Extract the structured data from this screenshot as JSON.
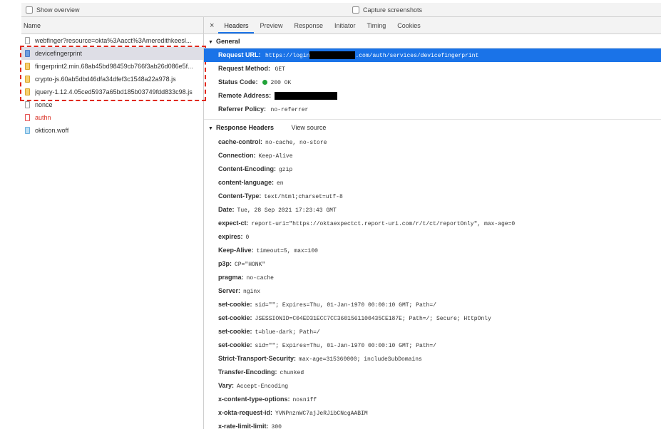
{
  "toolbar": {
    "show_overview": "Show overview",
    "capture_screenshots": "Capture screenshots"
  },
  "request_list": {
    "header": "Name",
    "items": [
      {
        "name": "webfinger?resource=okta%3Aacct%3Ameredithkeesl..."
      },
      {
        "name": "devicefingerprint"
      },
      {
        "name": "fingerprint2.min.68ab45bd98459cb766f3ab26d086e5f..."
      },
      {
        "name": "crypto-js.60ab5dbd46dfa34dfef3c1548a22a978.js"
      },
      {
        "name": "jquery-1.12.4.05ced5937a65bd185b03749fdd833c98.js"
      },
      {
        "name": "nonce"
      },
      {
        "name": "authn"
      },
      {
        "name": "okticon.woff"
      }
    ]
  },
  "tabs": [
    "Headers",
    "Preview",
    "Response",
    "Initiator",
    "Timing",
    "Cookies"
  ],
  "general": {
    "title": "General",
    "request_url_key": "Request URL:",
    "request_url_prefix": "https://login",
    "request_url_suffix": ".com/auth/services/devicefingerprint",
    "request_method_key": "Request Method:",
    "request_method": "GET",
    "status_code_key": "Status Code:",
    "status_code": "200 OK",
    "remote_address_key": "Remote Address:",
    "referrer_policy_key": "Referrer Policy:",
    "referrer_policy": "no-referrer"
  },
  "response_headers": {
    "title": "Response Headers",
    "view_source": "View source",
    "items": [
      {
        "key": "cache-control:",
        "value": "no-cache, no-store"
      },
      {
        "key": "Connection:",
        "value": "Keep-Alive"
      },
      {
        "key": "Content-Encoding:",
        "value": "gzip"
      },
      {
        "key": "content-language:",
        "value": "en"
      },
      {
        "key": "Content-Type:",
        "value": "text/html;charset=utf-8"
      },
      {
        "key": "Date:",
        "value": "Tue, 28 Sep 2021 17:23:43 GMT"
      },
      {
        "key": "expect-ct:",
        "value": "report-uri=\"https://oktaexpectct.report-uri.com/r/t/ct/reportOnly\", max-age=0"
      },
      {
        "key": "expires:",
        "value": "0"
      },
      {
        "key": "Keep-Alive:",
        "value": "timeout=5, max=100"
      },
      {
        "key": "p3p:",
        "value": "CP=\"HONK\""
      },
      {
        "key": "pragma:",
        "value": "no-cache"
      },
      {
        "key": "Server:",
        "value": "nginx"
      },
      {
        "key": "set-cookie:",
        "value": "sid=\"\"; Expires=Thu, 01-Jan-1970 00:00:10 GMT; Path=/"
      },
      {
        "key": "set-cookie:",
        "value": "JSESSIONID=C04ED31ECC7CC3601561100435CE187E; Path=/; Secure; HttpOnly"
      },
      {
        "key": "set-cookie:",
        "value": "t=blue-dark; Path=/"
      },
      {
        "key": "set-cookie:",
        "value": "sid=\"\"; Expires=Thu, 01-Jan-1970 00:00:10 GMT; Path=/"
      },
      {
        "key": "Strict-Transport-Security:",
        "value": "max-age=315360000; includeSubDomains"
      },
      {
        "key": "Transfer-Encoding:",
        "value": "chunked"
      },
      {
        "key": "Vary:",
        "value": "Accept-Encoding"
      },
      {
        "key": "x-content-type-options:",
        "value": "nosniff"
      },
      {
        "key": "x-okta-request-id:",
        "value": "YVNPnznWC7ajJeRJibCNcgAABIM"
      },
      {
        "key": "x-rate-limit-limit:",
        "value": "300"
      }
    ]
  },
  "colors": {
    "selected_tab": "#1a73e8",
    "highlight": "#1a73e8",
    "error": "#d93025",
    "annotation": "#e0291d"
  }
}
